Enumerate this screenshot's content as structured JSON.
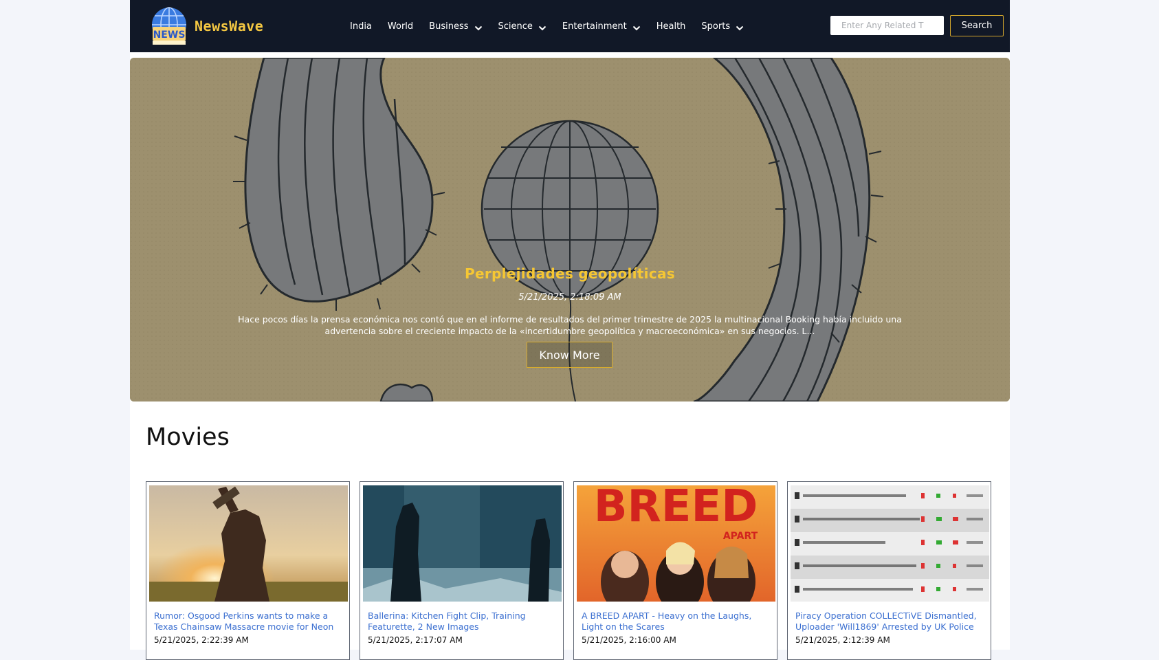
{
  "brand": {
    "name": "NewsWave",
    "logo_text": "NEWS"
  },
  "nav": {
    "items": [
      {
        "label": "India",
        "dropdown": false
      },
      {
        "label": "World",
        "dropdown": false
      },
      {
        "label": "Business",
        "dropdown": true
      },
      {
        "label": "Science",
        "dropdown": true
      },
      {
        "label": "Entertainment",
        "dropdown": true
      },
      {
        "label": "Health",
        "dropdown": false
      },
      {
        "label": "Sports",
        "dropdown": true
      }
    ],
    "search_placeholder": "Enter Any Related T",
    "search_label": "Search"
  },
  "hero": {
    "title": "Perplejidades geopolíticas",
    "date": "5/21/2025, 2:18:09 AM",
    "description": "Hace pocos días la prensa económica nos contó que en el informe de resultados del primer trimestre de 2025 la multinacional Booking había incluido una advertencia sobre el creciente impacto de la «incertidumbre geopolítica y macroeconómica» en sus negocios. L...",
    "button_label": "Know More"
  },
  "movies": {
    "heading": "Movies",
    "cards": [
      {
        "title": "Rumor: Osgood Perkins wants to make a Texas Chainsaw Massacre movie for Neon",
        "date": "5/21/2025, 2:22:39 AM"
      },
      {
        "title": "Ballerina: Kitchen Fight Clip, Training Featurette, 2 New Images",
        "date": "5/21/2025, 2:17:07 AM"
      },
      {
        "title": "A BREED APART - Heavy on the Laughs, Light on the Scares",
        "date": "5/21/2025, 2:16:00 AM",
        "image_text": "BREED",
        "image_subtext": "APART"
      },
      {
        "title": "Piracy Operation COLLECTiVE Dismantled, Uploader 'Will1869' Arrested by UK Police",
        "date": "5/21/2025, 2:12:39 AM"
      }
    ]
  },
  "colors": {
    "nav_bg": "#111827",
    "accent_gold": "#f5c842",
    "link_blue": "#3b6fd0"
  }
}
